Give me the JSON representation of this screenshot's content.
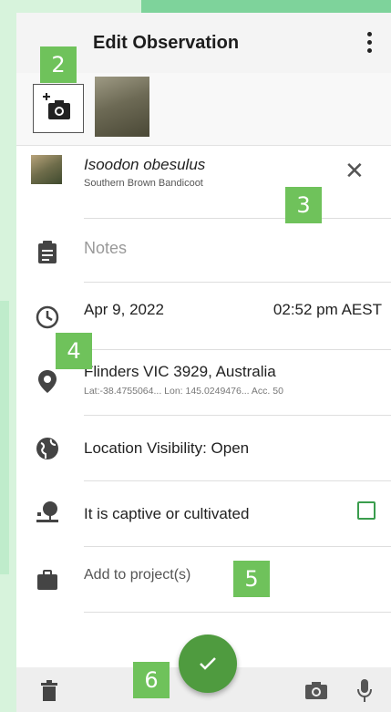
{
  "header": {
    "title": "Edit Observation",
    "menu_icon": "more-vert-icon"
  },
  "photos": {
    "add_icon": "add-photo-icon",
    "thumbnail_alt": "bandicoot photo"
  },
  "species": {
    "scientific_name": "Isoodon obesulus",
    "common_name": "Southern Brown Bandicoot",
    "clear_label": "✕"
  },
  "notes": {
    "placeholder": "Notes"
  },
  "datetime": {
    "date": "Apr 9, 2022",
    "time": "02:52 pm AEST"
  },
  "location": {
    "name": "Flinders VIC 3929, Australia",
    "details": "Lat:-38.4755064...   Lon: 145.0249476...   Acc. 50"
  },
  "visibility": {
    "label": "Location Visibility: Open"
  },
  "captive": {
    "label": "It is captive or cultivated",
    "checked": false
  },
  "project": {
    "label": "Add to project(s)"
  },
  "badges": [
    "2",
    "3",
    "4",
    "5",
    "6"
  ],
  "colors": {
    "accent": "#4f9b3f",
    "badge": "#6fc25b",
    "overlay": "#d7f3dc"
  }
}
